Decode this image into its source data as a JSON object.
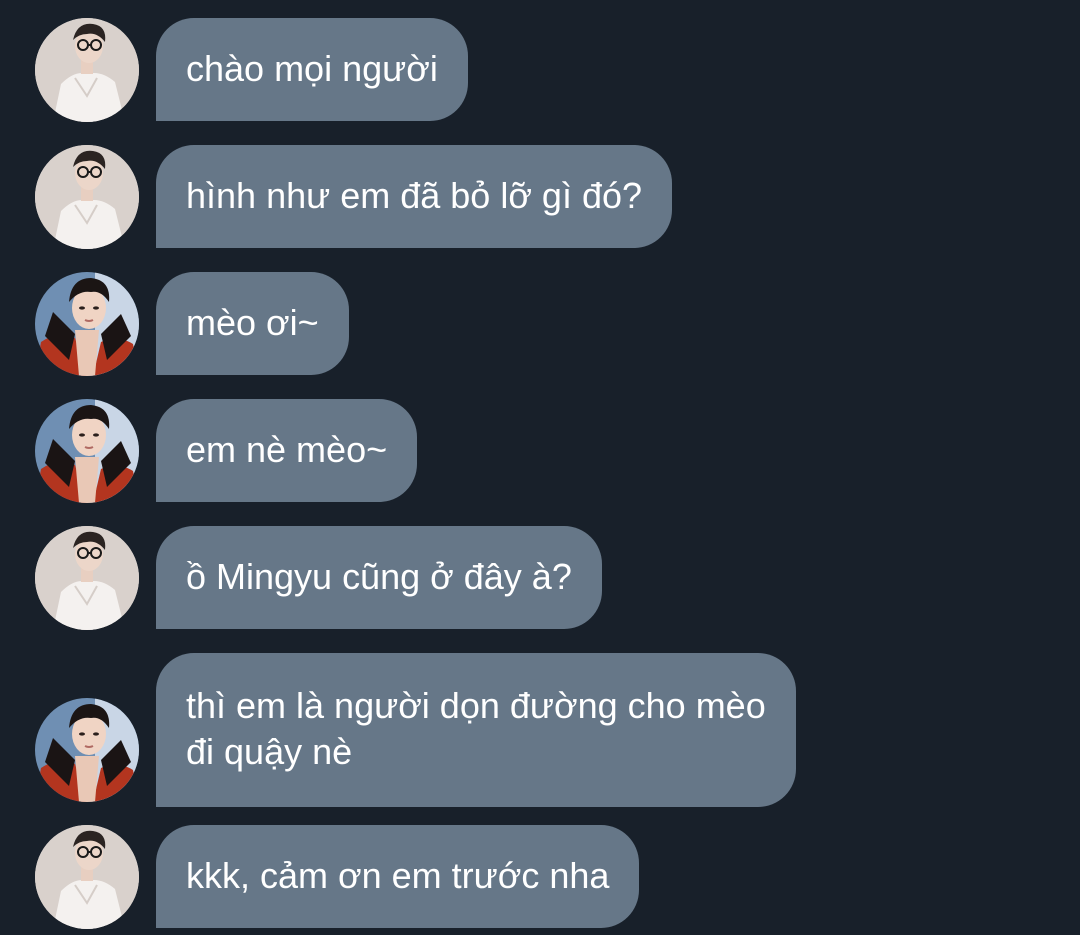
{
  "colors": {
    "background": "#18202a",
    "bubble": "#667788",
    "text": "#ffffff"
  },
  "messages": [
    {
      "avatar": "user-a-avatar",
      "text": "chào mọi người"
    },
    {
      "avatar": "user-a-avatar",
      "text": "hình như em đã bỏ lỡ gì đó?"
    },
    {
      "avatar": "user-b-avatar",
      "text": "mèo ơi~"
    },
    {
      "avatar": "user-b-avatar",
      "text": "em nè mèo~"
    },
    {
      "avatar": "user-a-avatar",
      "text": "ồ Mingyu cũng ở đây à?"
    },
    {
      "avatar": "user-b-avatar",
      "text": "thì em là người dọn đường cho mèo\nđi quậy nè"
    },
    {
      "avatar": "user-a-avatar",
      "text": "kkk, cảm ơn em trước nha"
    }
  ]
}
